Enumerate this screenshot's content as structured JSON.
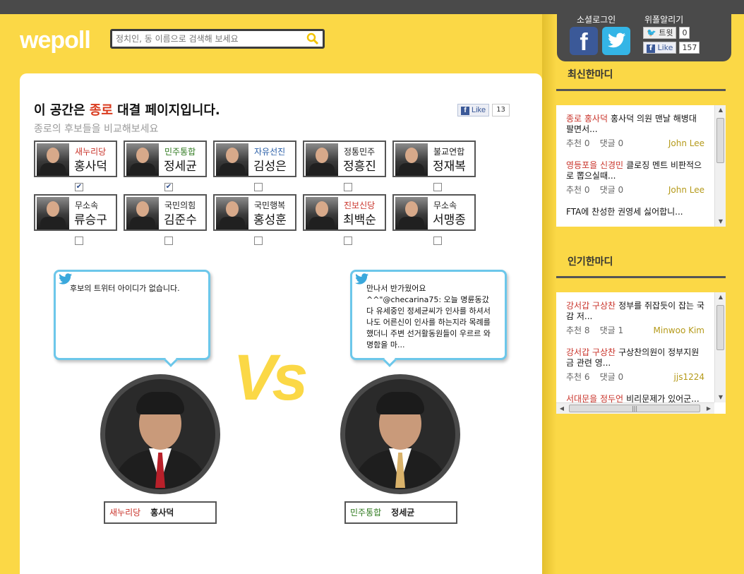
{
  "header": {
    "logo": "wepoll",
    "search_placeholder": "정치인, 동 이름으로 검색해 보세요"
  },
  "social": {
    "login_label": "소셜로그인",
    "share_label": "위폴알리기",
    "tweet_label": "트윗",
    "tweet_count": "0",
    "like_label": "Like",
    "like_count": "157"
  },
  "main": {
    "headline_prefix": "이 공간은 ",
    "region": "종로",
    "headline_suffix": " 대결 페이지입니다.",
    "subtitle": "종로의 후보들을 비교해보세요",
    "like_label": "Like",
    "like_count": "13"
  },
  "candidates": [
    {
      "party": "새누리당",
      "name": "홍사덕",
      "party_color": "#c9332a",
      "checked": true
    },
    {
      "party": "민주통합",
      "name": "정세균",
      "party_color": "#2f7a1f",
      "checked": true
    },
    {
      "party": "자유선진",
      "name": "김성은",
      "party_color": "#2a5fa8",
      "checked": false
    },
    {
      "party": "정통민주",
      "name": "정흥진",
      "party_color": "#222222",
      "checked": false
    },
    {
      "party": "불교연합",
      "name": "정재복",
      "party_color": "#222222",
      "checked": false
    },
    {
      "party": "무소속",
      "name": "류승구",
      "party_color": "#222222",
      "checked": false
    },
    {
      "party": "국민의힘",
      "name": "김준수",
      "party_color": "#222222",
      "checked": false
    },
    {
      "party": "국민행복",
      "name": "홍성훈",
      "party_color": "#222222",
      "checked": false
    },
    {
      "party": "진보신당",
      "name": "최백순",
      "party_color": "#c9332a",
      "checked": false
    },
    {
      "party": "무소속",
      "name": "서맹종",
      "party_color": "#222222",
      "checked": false
    }
  ],
  "versus": {
    "vs_text": "Vs",
    "left": {
      "tweet": "후보의 트위터 아이디가 없습니다.",
      "party": "새누리당",
      "name": "홍사덕",
      "party_color": "#c9332a",
      "tie_color": "#b8202a"
    },
    "right": {
      "tweet": "만나서 반가웠어요 ^^\"@checarina75: 오늘 명륜동갔다 유세중인 정세균씨가 인사를 하셔서 나도 어른신이 인사를 하는지라 목례를 했더니 주변 선거활동원들이 우르르 와 명함을 마...",
      "party": "민주통합",
      "name": "정세균",
      "party_color": "#2f7a1f",
      "tie_color": "#d9b26a"
    }
  },
  "sidebar": {
    "latest_title": "최신한마디",
    "latest": [
      {
        "who": "종로 홍사덕",
        "text": "홍사덕 의원 맨날 해병대 팔면서...",
        "rec_label": "추천",
        "rec": "0",
        "cmt_label": "댓글",
        "cmt": "0",
        "user": "John Lee"
      },
      {
        "who": "영등포을 신경민",
        "text": "클로징 멘트 비판적으로 뽑으실때...",
        "rec_label": "추천",
        "rec": "0",
        "cmt_label": "댓글",
        "cmt": "0",
        "user": "John Lee"
      },
      {
        "who": "",
        "text": "FTA에 찬성한 권영세 싫어합니...",
        "rec_label": "",
        "rec": "",
        "cmt_label": "",
        "cmt": "",
        "user": ""
      }
    ],
    "popular_title": "인기한마디",
    "popular": [
      {
        "who": "강서갑 구상찬",
        "text": "정부를 쥐잡듯이 잡는 국감 저...",
        "rec_label": "추천",
        "rec": "8",
        "cmt_label": "댓글",
        "cmt": "1",
        "user": "Minwoo Kim"
      },
      {
        "who": "강서갑 구상찬",
        "text": "구상찬의원이 정부지원금 관련 영...",
        "rec_label": "추천",
        "rec": "6",
        "cmt_label": "댓글",
        "cmt": "0",
        "user": "jjs1224"
      },
      {
        "who": "서대문을 정두언",
        "text": "비리문제가 있어군...",
        "rec_label": "",
        "rec": "",
        "cmt_label": "",
        "cmt": "",
        "user": ""
      }
    ]
  }
}
